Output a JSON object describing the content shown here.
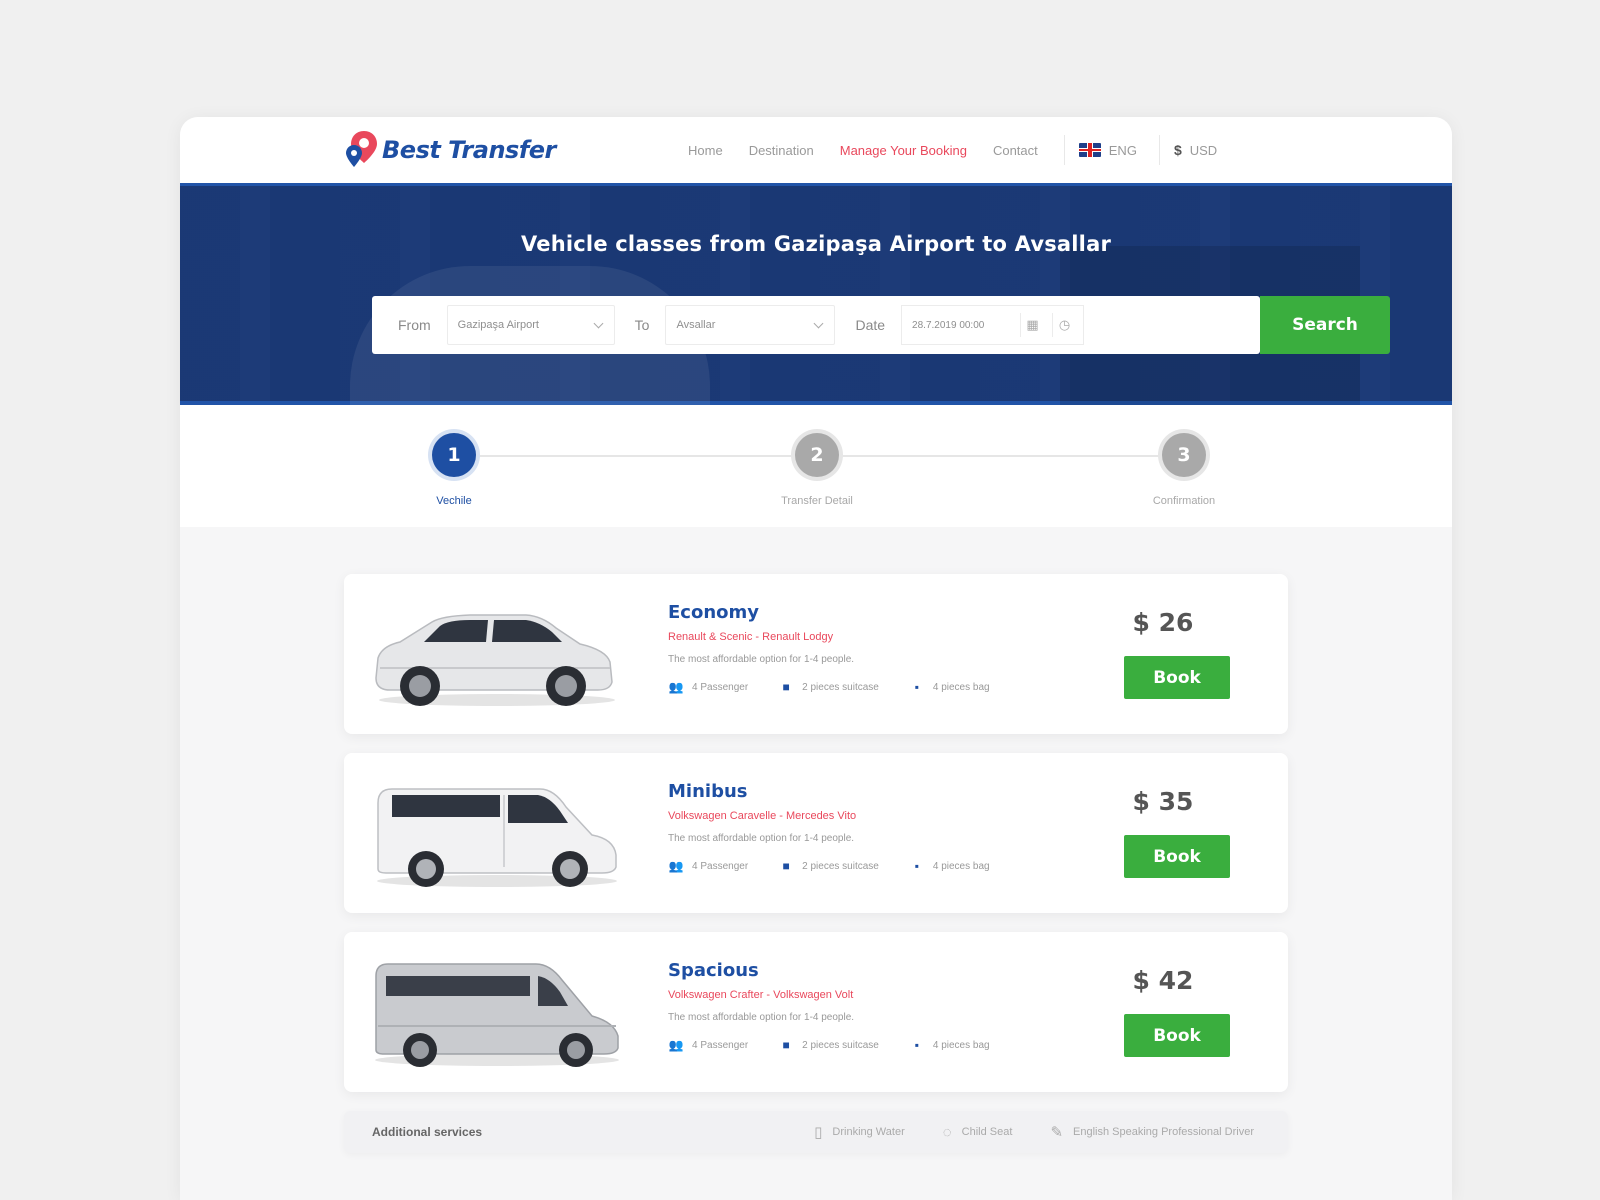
{
  "header": {
    "brand": "Best Transfer",
    "nav": [
      "Home",
      "Destination",
      "Manage Your Booking",
      "Contact"
    ],
    "active_nav": "Manage Your Booking",
    "language": "ENG",
    "currency_symbol": "$",
    "currency": "USD"
  },
  "hero": {
    "title": "Vehicle classes from Gazipaşa Airport to Avsallar",
    "from_label": "From",
    "from_value": "Gazipaşa Airport",
    "to_label": "To",
    "to_value": "Avsallar",
    "date_label": "Date",
    "date_value": "28.7.2019 00:00",
    "search_label": "Search"
  },
  "steps": [
    {
      "number": "1",
      "label": "Vechile",
      "active": true
    },
    {
      "number": "2",
      "label": "Transfer Detail",
      "active": false
    },
    {
      "number": "3",
      "label": "Confirmation",
      "active": false
    }
  ],
  "vehicles": [
    {
      "title": "Economy",
      "models": "Renault & Scenic - Renault Lodgy",
      "description": "The most affordable option for 1-4 people.",
      "passengers": "4 Passenger",
      "suitcases": "2 pieces suitcase",
      "bags": "4 pieces bag",
      "price": "$ 26",
      "book_label": "Book"
    },
    {
      "title": "Minibus",
      "models": "Volkswagen Caravelle - Mercedes Vito",
      "description": "The most affordable option for 1-4 people.",
      "passengers": "4 Passenger",
      "suitcases": "2 pieces suitcase",
      "bags": "4 pieces bag",
      "price": "$ 35",
      "book_label": "Book"
    },
    {
      "title": "Spacious",
      "models": "Volkswagen Crafter - Volkswagen Volt",
      "description": "The most affordable option for 1-4 people.",
      "passengers": "4 Passenger",
      "suitcases": "2 pieces suitcase",
      "bags": "4 pieces bag",
      "price": "$ 42",
      "book_label": "Book"
    }
  ],
  "services": {
    "title": "Additional services",
    "items": [
      "Drinking Water",
      "Child Seat",
      "English Speaking Professional Driver"
    ]
  },
  "colors": {
    "brand_blue": "#1e4fa3",
    "accent_red": "#e9485c",
    "action_green": "#3aae3e"
  }
}
